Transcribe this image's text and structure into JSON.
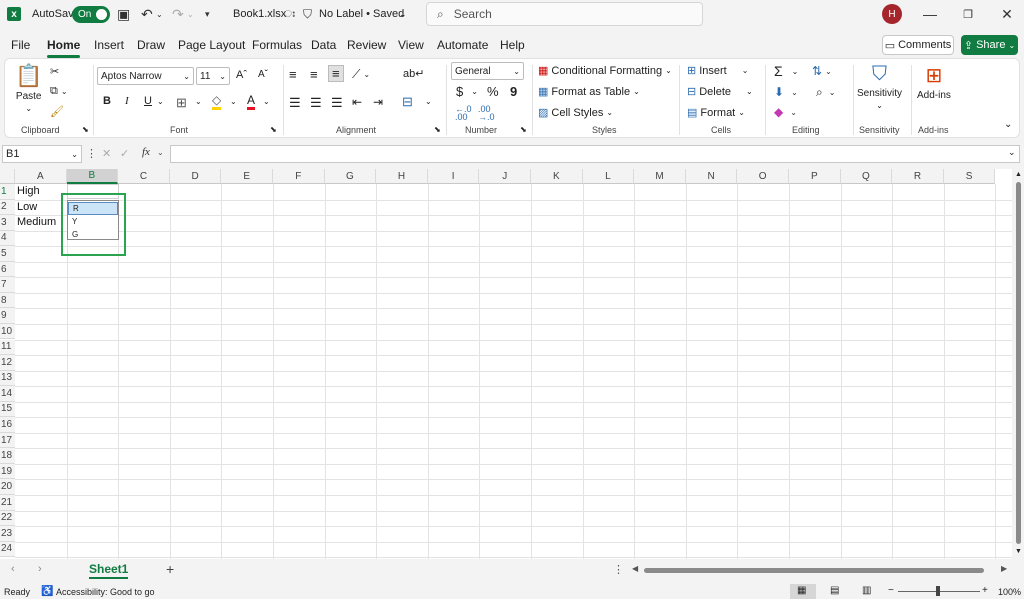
{
  "titlebar": {
    "app_icon": "excel-logo-icon",
    "autosave_label": "AutoSave",
    "autosave_state": "On",
    "filename": "Book1.xlsx",
    "sensitivity": "No Label • Saved",
    "search_placeholder": "Search",
    "user_initial": "H"
  },
  "menu": {
    "items": [
      "File",
      "Home",
      "Insert",
      "Draw",
      "Page Layout",
      "Formulas",
      "Data",
      "Review",
      "View",
      "Automate",
      "Help"
    ],
    "active": "Home",
    "comments_label": "Comments",
    "share_label": "Share"
  },
  "ribbon": {
    "clipboard": {
      "paste": "Paste",
      "label": "Clipboard"
    },
    "font": {
      "name": "Aptos Narrow",
      "size": "11",
      "grow": "Aˆ",
      "shrink": "Aˇ",
      "bold": "B",
      "italic": "I",
      "underline": "U",
      "font_color_letter": "A",
      "label": "Font"
    },
    "alignment": {
      "label": "Alignment"
    },
    "number": {
      "format": "General",
      "currency": "$",
      "percent": "%",
      "comma": "9",
      "inc_dec": "←.0\n.00",
      "dec_dec": ".00\n→.0",
      "label": "Number"
    },
    "styles": {
      "conditional": "Conditional Formatting",
      "table": "Format as Table",
      "cell": "Cell Styles",
      "label": "Styles"
    },
    "cells": {
      "insert": "Insert",
      "delete": "Delete",
      "format": "Format",
      "label": "Cells"
    },
    "editing": {
      "sum": "Σ",
      "label": "Editing"
    },
    "sensitivity": {
      "button": "Sensitivity",
      "label": "Sensitivity"
    },
    "addins": {
      "button": "Add-ins",
      "label": "Add-ins"
    },
    "accent": "#107c41"
  },
  "formula": {
    "name_box": "B1",
    "fx": "fx",
    "content": ""
  },
  "grid": {
    "columns": [
      "A",
      "B",
      "C",
      "D",
      "E",
      "F",
      "G",
      "H",
      "I",
      "J",
      "K",
      "L",
      "M",
      "N",
      "O",
      "P",
      "Q",
      "R",
      "S"
    ],
    "rows": [
      "1",
      "2",
      "3",
      "4",
      "5",
      "6",
      "7",
      "8",
      "9",
      "10",
      "11",
      "12",
      "13",
      "14",
      "15",
      "16",
      "17",
      "18",
      "19",
      "20",
      "21",
      "22",
      "23",
      "24"
    ],
    "selected_column": "B",
    "selected_row": "1",
    "cells": [
      {
        "ref": "A1",
        "value": "High"
      },
      {
        "ref": "A2",
        "value": "Low"
      },
      {
        "ref": "A3",
        "value": "Medium"
      }
    ]
  },
  "dropdown": {
    "options": [
      "R",
      "Y",
      "G"
    ],
    "highlighted": "R"
  },
  "sheets": {
    "tabs": [
      "Sheet1"
    ],
    "active": "Sheet1",
    "add": "+"
  },
  "status": {
    "ready": "Ready",
    "accessibility": "Accessibility: Good to go",
    "zoom": "100%"
  }
}
